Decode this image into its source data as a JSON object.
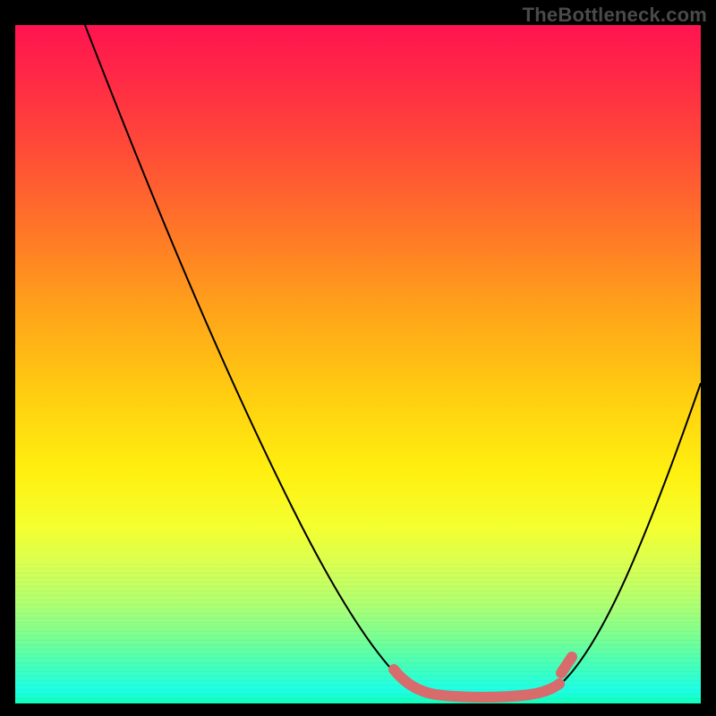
{
  "watermark": "TheBottleneck.com",
  "colors": {
    "page_bg": "#000000",
    "watermark_text": "#4a4a4a",
    "curve": "#000000",
    "highlight": "#d86b6b"
  },
  "chart_data": {
    "type": "line",
    "title": "",
    "xlabel": "",
    "ylabel": "",
    "xlim": [
      0,
      100
    ],
    "ylim": [
      0,
      100
    ],
    "grid": false,
    "series": [
      {
        "name": "left-branch",
        "x": [
          10,
          15,
          20,
          25,
          30,
          35,
          40,
          45,
          50,
          53,
          55,
          57
        ],
        "y": [
          100,
          89,
          78,
          67,
          56,
          45,
          34,
          23,
          12,
          6,
          3,
          2
        ]
      },
      {
        "name": "valley-floor",
        "x": [
          57,
          60,
          63,
          66,
          69,
          72,
          75,
          77
        ],
        "y": [
          2,
          1,
          1,
          1,
          1,
          1,
          2,
          3
        ]
      },
      {
        "name": "right-branch",
        "x": [
          77,
          80,
          83,
          86,
          89,
          92,
          95,
          98,
          100
        ],
        "y": [
          3,
          6,
          11,
          17,
          24,
          32,
          40,
          48,
          54
        ]
      }
    ],
    "highlight_region": {
      "name": "bottleneck-sweet-spot",
      "x": [
        55,
        58,
        62,
        66,
        70,
        73,
        76,
        77,
        78,
        79
      ],
      "y": [
        5,
        2,
        1,
        1,
        1,
        1,
        2,
        3,
        5,
        7
      ]
    },
    "background_gradient_stops": [
      {
        "pos": 0.0,
        "color": "#ff1450"
      },
      {
        "pos": 0.3,
        "color": "#ff7528"
      },
      {
        "pos": 0.55,
        "color": "#ffcf10"
      },
      {
        "pos": 0.74,
        "color": "#f4ff30"
      },
      {
        "pos": 0.9,
        "color": "#7dff90"
      },
      {
        "pos": 1.0,
        "color": "#12ffb8"
      }
    ]
  }
}
